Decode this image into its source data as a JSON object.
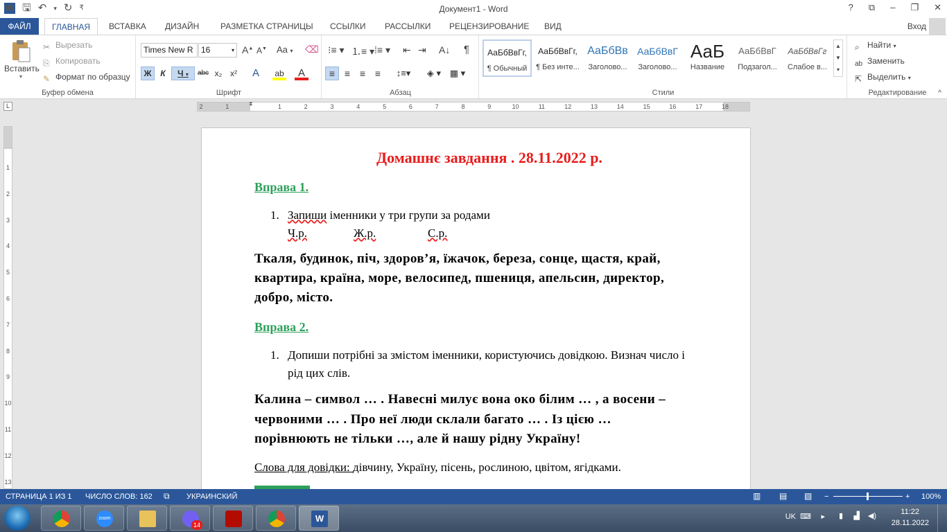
{
  "window": {
    "title": "Документ1 - Word",
    "controls": [
      "?",
      "⧉",
      "–",
      "❐",
      "✕"
    ]
  },
  "tabs": {
    "file": "ФАЙЛ",
    "items": [
      "ГЛАВНАЯ",
      "ВСТАВКА",
      "ДИЗАЙН",
      "РАЗМЕТКА СТРАНИЦЫ",
      "ССЫЛКИ",
      "РАССЫЛКИ",
      "РЕЦЕНЗИРОВАНИЕ",
      "ВИД"
    ],
    "signin": "Вход"
  },
  "clipboard": {
    "paste": "Вставить",
    "cut": "Вырезать",
    "copy": "Копировать",
    "format_painter": "Формат по образцу",
    "label": "Буфер обмена"
  },
  "font": {
    "name": "Times New R",
    "size": "16",
    "label": "Шрифт",
    "bold": "Ж",
    "italic": "К",
    "underline": "Ч",
    "strike": "abc",
    "sub": "x₂",
    "sup": "x²",
    "case": "Aa"
  },
  "paragraph": {
    "label": "Абзац"
  },
  "styles": {
    "label": "Стили",
    "items": [
      {
        "sample": "АаБбВвГг,",
        "name": "¶ Обычный"
      },
      {
        "sample": "АаБбВвГг,",
        "name": "¶ Без инте..."
      },
      {
        "sample": "АаБбВв",
        "name": "Заголово..."
      },
      {
        "sample": "АаБбВвГ",
        "name": "Заголово..."
      },
      {
        "sample": "АаБ",
        "name": "Название"
      },
      {
        "sample": "АаБбВвГ",
        "name": "Подзагол..."
      },
      {
        "sample": "АаБбВвГг",
        "name": "Слабое в..."
      }
    ]
  },
  "editing": {
    "find": "Найти",
    "replace": "Заменить",
    "select": "Выделить",
    "label": "Редактирование"
  },
  "ruler": {
    "h_numbers": [
      "2",
      "1",
      "",
      "1",
      "2",
      "3",
      "4",
      "5",
      "6",
      "7",
      "8",
      "9",
      "10",
      "11",
      "12",
      "13",
      "14",
      "15",
      "16",
      "17",
      "18"
    ],
    "v_numbers": [
      "1",
      "2",
      "3",
      "4",
      "5",
      "6",
      "7",
      "8",
      "9",
      "10",
      "11",
      "12",
      "13"
    ]
  },
  "document": {
    "title": "Домашнє завдання . 28.11.2022 р.",
    "ex1_head": "Вправа 1.",
    "ex1_num": "1.",
    "ex1_task_word": "Запиши",
    "ex1_task_rest": " іменники у три групи за родами",
    "ex1_genders": [
      "Ч.р.",
      "Ж.р.",
      "С.р."
    ],
    "ex1_words": [
      "Ткаля, будинок, піч, здоров’я, їжачок, береза, сонце, щастя, край,",
      "квартира, країна, море, велосипед, пшениця, апельсин, директор,",
      "добро, місто."
    ],
    "ex2_head": "Вправа 2.",
    "ex2_num": "1.",
    "ex2_task": [
      "Допиши потрібні за змістом іменники, користуючись довідкою. Визнач число і",
      "рід цих слів."
    ],
    "ex2_text": [
      "Калина – символ  … . Навесні милує вона око білим   … ,  а восени –",
      "червоними   … .   Про неї люди склали багато   … .   Із цією   …",
      "порівнюють не тільки    …,   але й нашу рідну Україну!"
    ],
    "hint_label": "Слова для довідки: ",
    "hint_words": " дівчину, Україну, пісень, рослиною, цвітом, ягідками."
  },
  "status": {
    "page": "СТРАНИЦА 1 ИЗ 1",
    "words": "ЧИСЛО СЛОВ: 162",
    "lang": "УКРАИНСКИЙ",
    "zoom": "100%"
  },
  "taskbar": {
    "lang": "UK",
    "time": "11:22",
    "date": "28.11.2022",
    "viber_badge": "14",
    "zoom_label": "zoom"
  },
  "colors": {
    "accent": "#2b579a",
    "title_red": "#e81c1c",
    "heading_green": "#2ca05a"
  }
}
